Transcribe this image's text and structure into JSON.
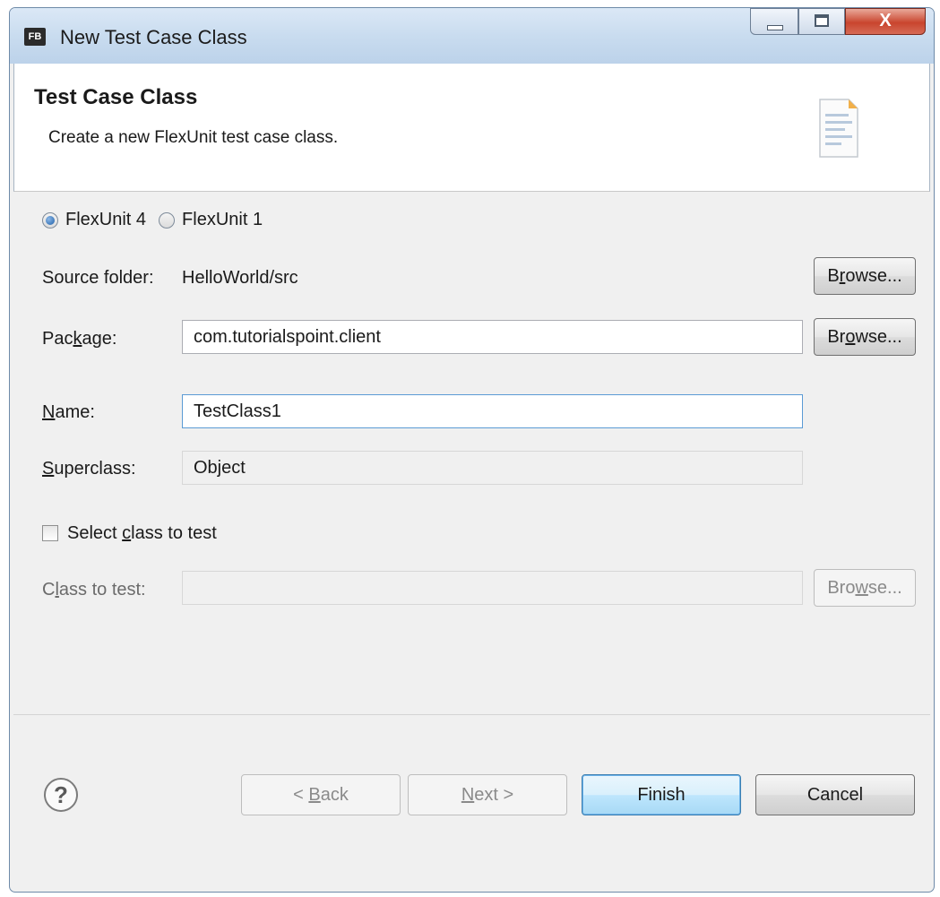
{
  "window": {
    "app_icon_text": "FB",
    "title": "New Test Case Class",
    "close_glyph": "X"
  },
  "header": {
    "title": "Test Case Class",
    "description": "Create a new FlexUnit test case class."
  },
  "version_options": [
    {
      "label": "FlexUnit 4",
      "selected": true
    },
    {
      "label": "FlexUnit 1",
      "selected": false
    }
  ],
  "source_folder": {
    "label": "Source folder:",
    "value": "HelloWorld/src",
    "browse_label": [
      "B",
      "r",
      "owse..."
    ]
  },
  "package": {
    "label": [
      "Pac",
      "k",
      "age:"
    ],
    "value": "com.tutorialspoint.client",
    "browse_label": [
      "Br",
      "o",
      "wse..."
    ]
  },
  "name": {
    "label": [
      "",
      "N",
      "ame:"
    ],
    "value": "TestClass1"
  },
  "superclass": {
    "label": [
      "",
      "S",
      "uperclass:"
    ],
    "value": "Object"
  },
  "select_class": {
    "label": [
      "Select ",
      "c",
      "lass to test"
    ],
    "checked": false
  },
  "class_to_test": {
    "label": [
      "C",
      "l",
      "ass to test:"
    ],
    "value": "",
    "browse_label": [
      "Bro",
      "w",
      "se..."
    ]
  },
  "footer": {
    "help_glyph": "?",
    "back_label": [
      "< ",
      "B",
      "ack"
    ],
    "next_label": [
      "",
      "N",
      "ext >"
    ],
    "finish_label": "Finish",
    "cancel_label": "Cancel"
  },
  "colors": {
    "title_bar": "#c9dcef",
    "close_button": "#c9452e",
    "default_button_border": "#3c7fb1"
  },
  "icons": [
    "flash-builder-app-icon",
    "minimize-icon",
    "maximize-icon",
    "close-icon",
    "document-icon",
    "help-icon"
  ]
}
